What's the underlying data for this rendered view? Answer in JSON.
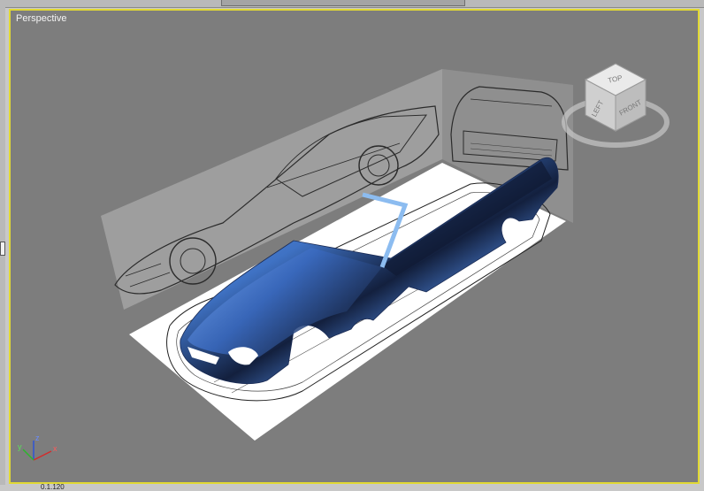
{
  "viewport": {
    "label": "Perspective"
  },
  "viewcube": {
    "faces": {
      "top": "TOP",
      "left": "LEFT",
      "front": "FRONT"
    }
  },
  "axis_gizmo": {
    "x": "x",
    "y": "y",
    "z": "z"
  },
  "status": {
    "partial_value": "0.1.120"
  },
  "colors": {
    "viewport_bg": "#7d7d7d",
    "active_border": "#e1d934",
    "model_blue": "#3f72c4",
    "x_axis": "#d42b2b",
    "y_axis": "#2db52d",
    "z_axis": "#2e55d6"
  }
}
